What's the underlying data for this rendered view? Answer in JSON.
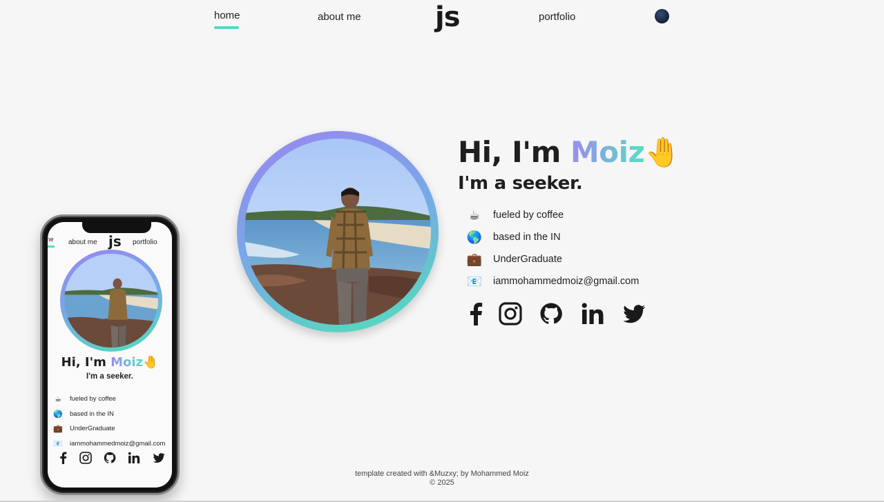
{
  "nav": {
    "home": "home",
    "about": "about me",
    "logo": "js",
    "portfolio": "portfolio"
  },
  "hero": {
    "greeting": "Hi, I'm ",
    "name": "Moiz",
    "wave": "🤚",
    "tagline": "I'm a seeker.",
    "info": [
      {
        "icon": "☕",
        "label": "fueled by coffee"
      },
      {
        "icon": "🌎",
        "label": "based in the IN"
      },
      {
        "icon": "💼",
        "label": "UnderGraduate"
      },
      {
        "icon": "📧",
        "label": "iammohammedmoiz@gmail.com"
      }
    ],
    "socials": [
      "facebook-icon",
      "instagram-icon",
      "github-icon",
      "linkedin-icon",
      "twitter-icon"
    ]
  },
  "footer": {
    "credit": "template created with &Muzxy; by Mohammed Moiz",
    "copyright": "© 2025"
  },
  "colors": {
    "accent_teal": "#4fdcc0",
    "accent_purple": "#9a8cf0",
    "background": "#f6f6f6",
    "text": "#1f1f1f"
  }
}
